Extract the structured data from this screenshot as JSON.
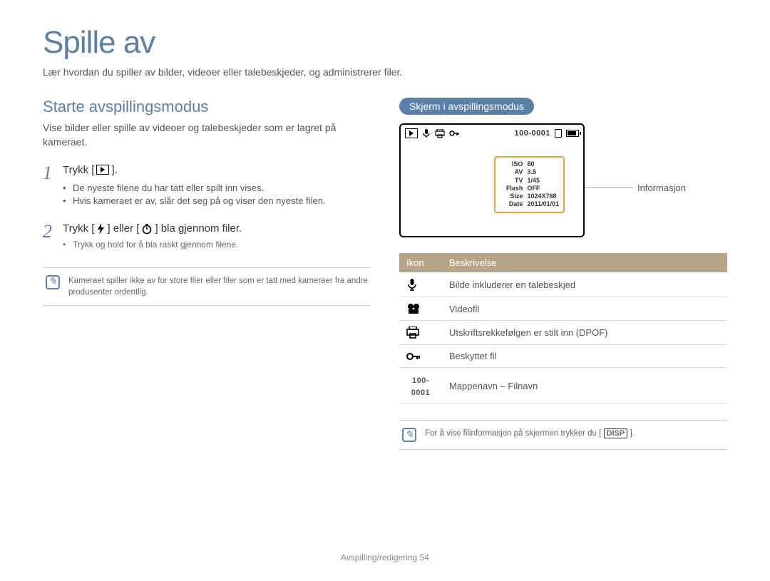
{
  "page_title": "Spille av",
  "page_subtitle": "Lær hvordan du spiller av bilder, videoer eller talebeskjeder, og administrerer filer.",
  "left": {
    "section_heading": "Starte avspillingsmodus",
    "section_desc": "Vise bilder eller spille av videoer og talebeskjeder som er lagret på kameraet.",
    "step1": {
      "num": "1",
      "text_before": "Trykk [",
      "text_after": "].",
      "bullets": [
        "De nyeste filene du har tatt eller spilt inn vises.",
        "Hvis kameraet er av, slår det seg på og viser den nyeste filen."
      ]
    },
    "step2": {
      "num": "2",
      "t1": "Trykk [",
      "t2": "] eller [",
      "t3": "] bla gjennom filer.",
      "sub_bullets": [
        "Trykk og hold for å bla raskt gjennom filene."
      ]
    },
    "note": "Kameraet spiller ikke av for store filer eller filer som er tatt med kameraer fra andre produsenter ordentlig."
  },
  "right": {
    "pill": "Skjerm i avspillingsmodus",
    "lcd": {
      "folder_file": "100-0001",
      "info_rows": [
        {
          "label": "ISO",
          "value": "80"
        },
        {
          "label": "AV",
          "value": "3.5"
        },
        {
          "label": "TV",
          "value": "1/45"
        },
        {
          "label": "Flash",
          "value": "OFF"
        },
        {
          "label": "Size",
          "value": "1024X768"
        },
        {
          "label": "Date",
          "value": "2011/01/01"
        }
      ],
      "callout": "Informasjon"
    },
    "table": {
      "th_icon": "Ikon",
      "th_desc": "Beskrivelse",
      "rows": [
        {
          "icon": "mic-icon",
          "desc": "Bilde inkluderer en talebeskjed"
        },
        {
          "icon": "film-icon",
          "desc": "Videofil"
        },
        {
          "icon": "printer-icon",
          "desc": "Utskriftsrekkefølgen er stilt inn (DPOF)"
        },
        {
          "icon": "key-icon",
          "desc": "Beskyttet fil"
        },
        {
          "icon": "folder-num",
          "desc": "Mappenavn – Filnavn"
        }
      ],
      "folder_num_label": "100-0001"
    },
    "note": {
      "before": "For å vise filinformasjon på skjermen trykker du [",
      "disp": "DISP",
      "after": "]."
    }
  },
  "footer": {
    "section": "Avspilling/redigering",
    "page_num": "54"
  }
}
